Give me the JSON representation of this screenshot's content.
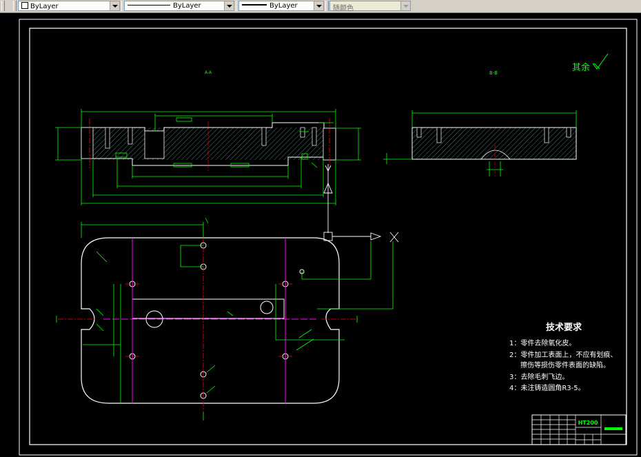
{
  "toolbar": {
    "layer_value": "ByLayer",
    "linetype_value": "ByLayer",
    "lineweight_value": "ByLayer",
    "plotstyle_value": "随颜色"
  },
  "drawing": {
    "section_a_label": "A-A",
    "section_b_label": "B-B",
    "surface_note": "其余",
    "tech_title": "技术要求",
    "notes": [
      "1：零件去除氧化皮。",
      "2：零件加工表面上，不应有划痕、",
      "擦伤等损伤零件表面的缺陷。",
      "3：去除毛刺飞边。",
      "4：未注铸造圆角R3-5。"
    ],
    "material": "HT200"
  },
  "colors": {
    "background": "#000000",
    "outline": "#ffffff",
    "dimension": "#00ff00",
    "centerline": "#ff0000",
    "hatch": "#6ed6c7",
    "magenta": "#ff00ff"
  }
}
